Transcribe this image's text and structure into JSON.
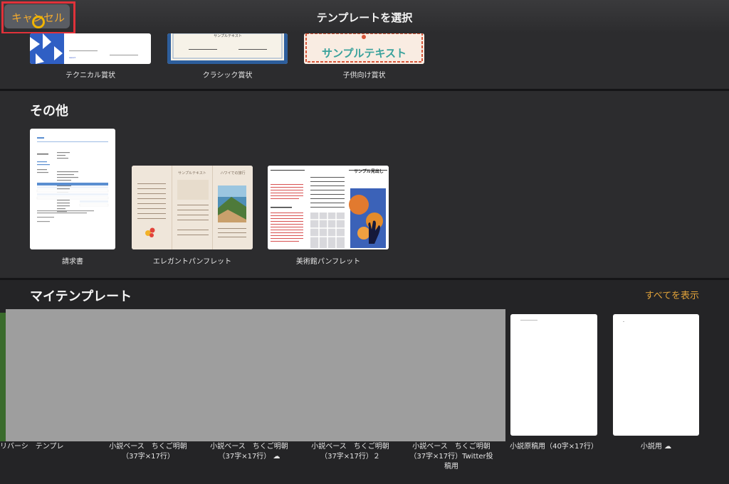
{
  "header": {
    "title": "テンプレートを選択",
    "cancel_label": "キャンセル"
  },
  "certificates": [
    {
      "caption": "テクニカル賞状"
    },
    {
      "caption": "クラシック賞状",
      "sample_text": "サンプルテキスト"
    },
    {
      "caption": "子供向け賞状",
      "sample_text": "サンプルテキスト"
    }
  ],
  "other": {
    "heading": "その他",
    "items": [
      {
        "caption": "請求書"
      },
      {
        "caption": "エレガントパンフレット",
        "panel_title_1": "サンプルテキスト",
        "panel_title_2": "ハワイでの旅行"
      },
      {
        "caption": "美術館パンフレット",
        "panel_title": "サンプル見出し"
      }
    ]
  },
  "my_templates": {
    "heading": "マイテンプレート",
    "show_all": "すべてを表示",
    "items": [
      {
        "caption": "リバーシ　テンプレ"
      },
      {
        "caption_line1": "小説ベース　ちくご明朝",
        "caption_line2": "（37字×17行）"
      },
      {
        "caption_line1": "小説ベース　ちくご明朝",
        "caption_line2": "（37字×17行）"
      },
      {
        "caption_line1": "小説ベース　ちくご明朝",
        "caption_line2": "（37字×17行）２"
      },
      {
        "caption_line1": "小説ベース　ちくご明朝",
        "caption_line2": "（37字×17行）Twitter投",
        "caption_line3": "稿用"
      },
      {
        "caption": "小説原稿用（40字×17行）"
      },
      {
        "caption": "小説用"
      }
    ]
  },
  "colors": {
    "accent": "#f0a930",
    "highlight": "#e0323a",
    "background": "#2c2c2e"
  },
  "icons": [
    "cloud-download-icon"
  ]
}
